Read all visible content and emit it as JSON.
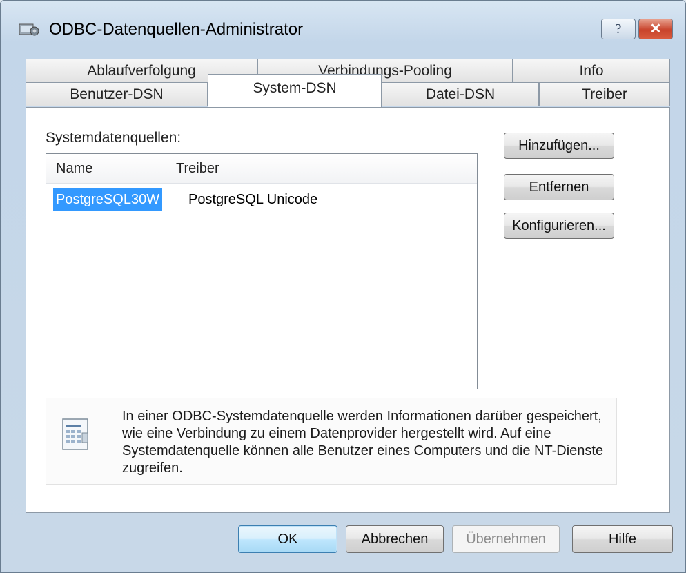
{
  "window": {
    "title": "ODBC-Datenquellen-Administrator",
    "help_caption": "?",
    "close_caption": "✕"
  },
  "tabs_row_back": [
    {
      "label": "Ablaufverfolgung"
    },
    {
      "label": "Verbindungs-Pooling"
    },
    {
      "label": "Info"
    }
  ],
  "tabs_row_front": [
    {
      "label": "Benutzer-DSN"
    },
    {
      "label": "System-DSN",
      "active": true
    },
    {
      "label": "Datei-DSN"
    },
    {
      "label": "Treiber"
    }
  ],
  "panel": {
    "group_label": "Systemdatenquellen:",
    "columns": {
      "name": "Name",
      "driver": "Treiber"
    },
    "rows": [
      {
        "name": "PostgreSQL30W",
        "driver": "PostgreSQL Unicode",
        "selected": true
      }
    ],
    "buttons": {
      "add": "Hinzufügen...",
      "remove": "Entfernen",
      "configure": "Konfigurieren..."
    },
    "info_text": "In einer ODBC-Systemdatenquelle werden Informationen darüber gespeichert, wie eine Verbindung zu einem Datenprovider hergestellt wird. Auf eine Systemdatenquelle können alle Benutzer eines Computers und die NT-Dienste zugreifen."
  },
  "footer": {
    "ok": "OK",
    "cancel": "Abbrechen",
    "apply": "Übernehmen",
    "help": "Hilfe"
  },
  "colors": {
    "selection": "#3399ff",
    "close_button": "#c8432b",
    "default_button_border": "#3c7fb1"
  },
  "icons": {
    "app": "odbc-admin-icon",
    "info": "database-document-icon"
  }
}
